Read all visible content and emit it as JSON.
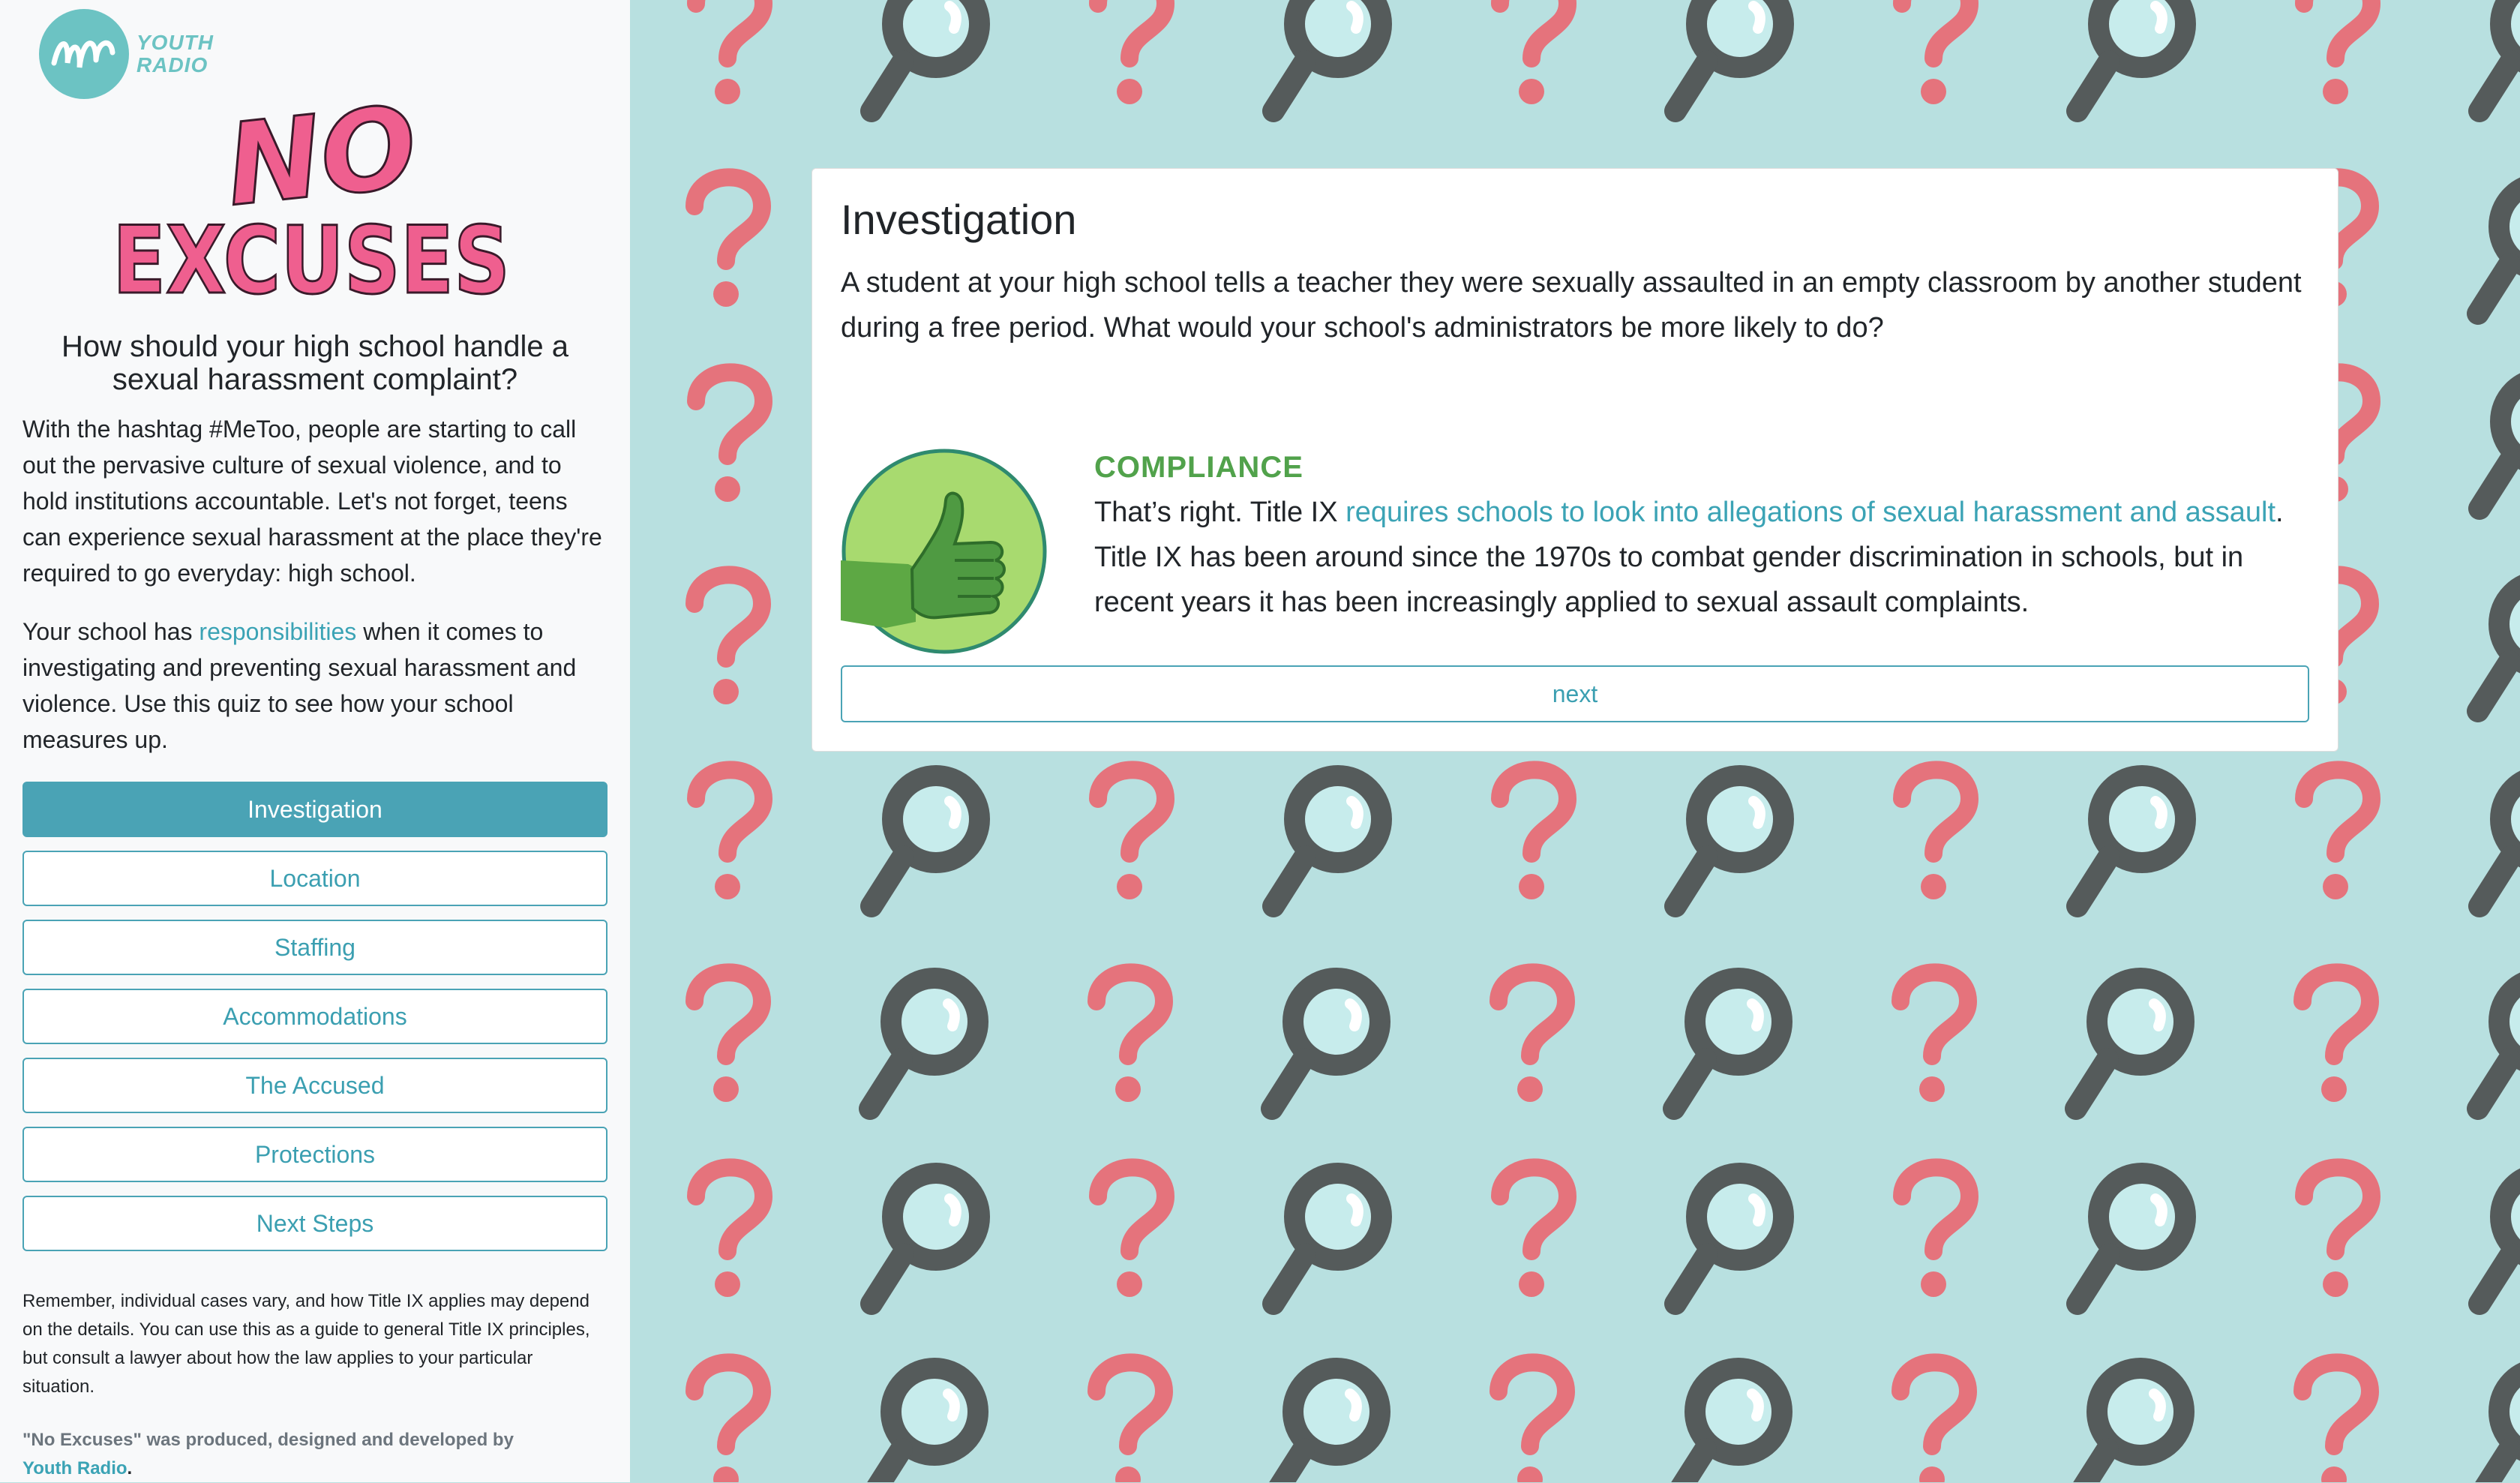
{
  "sidebar": {
    "logo_text_line1": "YOUTH",
    "logo_text_line2": "RADIO",
    "title_line1": "NO",
    "title_line2": "EXCUSES",
    "question": "How should your high school handle a sexual harassment complaint?",
    "intro1": "With the hashtag #MeToo, people are starting to call out the pervasive culture of sexual violence, and to hold institutions accountable. Let's not forget, teens can experience sexual harassment at the place they're required to go everyday: high school.",
    "intro2_pre": "Your school has ",
    "intro2_link": "responsibilities",
    "intro2_post": " when it comes to investigating and preventing sexual harassment and violence. Use this quiz to see how your school measures up.",
    "nav": [
      {
        "label": "Investigation",
        "active": true
      },
      {
        "label": "Location",
        "active": false
      },
      {
        "label": "Staffing",
        "active": false
      },
      {
        "label": "Accommodations",
        "active": false
      },
      {
        "label": "The Accused",
        "active": false
      },
      {
        "label": "Protections",
        "active": false
      },
      {
        "label": "Next Steps",
        "active": false
      }
    ],
    "disclaimer": "Remember, individual cases vary, and how Title IX applies may depend on the details. You can use this as a guide to general Title IX principles, but consult a lawyer about how the law applies to your particular situation.",
    "credit_pre": "\"No Excuses\" was produced, designed and developed by",
    "credit_link": "Youth Radio",
    "credit_post": "."
  },
  "card": {
    "title": "Investigation",
    "question": "A student at your high school tells a teacher they were sexually assaulted in an empty classroom by another student during a free period. What would your school's administrators be more likely to do?",
    "result_label": "COMPLIANCE",
    "result_pre": "That’s right. Title IX ",
    "result_link": "requires schools to look into allegations of sexual harassment and assault",
    "result_post": ". Title IX has been around since the 1970s to combat gender discrimination in schools, but in recent years it has been increasingly applied to sexual assault complaints.",
    "next_label": "next"
  },
  "colors": {
    "accent": "#4aa3b5",
    "compliance_green": "#51a24b",
    "title_pink": "#ef5f8f",
    "background_teal": "#b8e0e0",
    "question_mark_red": "#e5737c",
    "magnifier_gray": "#555b5b"
  },
  "icons": [
    "youth-radio-logo-icon",
    "thumbs-up-icon",
    "question-mark-icon",
    "magnifier-icon"
  ]
}
